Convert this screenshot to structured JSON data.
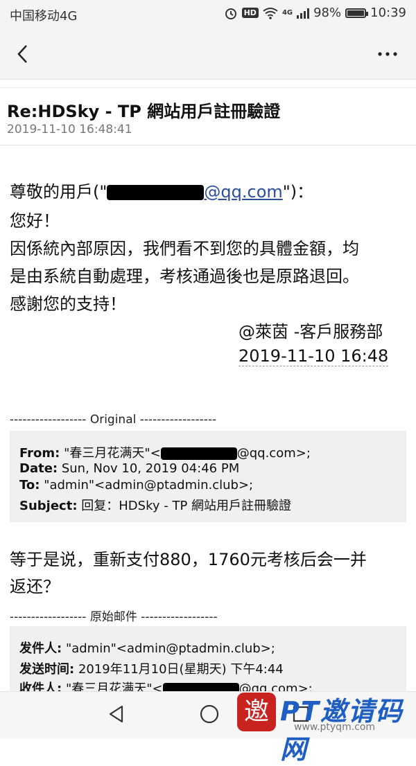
{
  "status_bar": {
    "carrier": "中国移动4G",
    "hd": "HD",
    "network": "4G",
    "battery": "98%",
    "battery_level": 0.98,
    "time": "10:39"
  },
  "header": {
    "subject": "Re:HDSky - TP 網站用戶註冊驗證",
    "date": "2019-11-10 16:48:41"
  },
  "message": {
    "greeting_prefix": "尊敬的用戶(\"",
    "greeting_email_visible": "@qq.com",
    "greeting_suffix": "\")：",
    "hello": "您好！",
    "body_line1": "因係統內部原因，我們看不到您的具體金額，均",
    "body_line2": "是由系統自動處理，考核通過後也是原路退回。",
    "thanks": "感謝您的支持！",
    "signature": "@萊茵 -客戶服務部",
    "signature_date": "2019-11-10 16:48"
  },
  "original1": {
    "divider": "------------------ Original ------------------",
    "from_label": "From:",
    "from_value_prefix": "\"春三月花满天\"<",
    "from_value_suffix": "@qq.com>;",
    "date_label": "Date:",
    "date_value": "Sun, Nov 10, 2019 04:46 PM",
    "to_label": "To:",
    "to_value": "\"admin\"<admin@ptadmin.club>;",
    "subject_label": "Subject:",
    "subject_value": "回复：HDSky - TP 網站用戶註冊驗證"
  },
  "reply": {
    "line1": "等于是说，重新支付880，1760元考核后会一并",
    "line2": "返还？"
  },
  "original2": {
    "divider": "------------------ 原始邮件 ------------------",
    "from_label": "发件人:",
    "from_value": "\"admin\"<admin@ptadmin.club>;",
    "time_label": "发送时间:",
    "time_value": "2019年11月10日(星期天) 下午4:44",
    "to_label": "收件人:",
    "to_value_prefix": "\"春三月花满天\"<",
    "to_value_suffix": "@qq.com>;"
  },
  "watermark": {
    "logo": "邀",
    "title": "PT邀请码网",
    "url": "www.ptyqm.com"
  },
  "icons": [
    "back-arrow-icon",
    "more-icon",
    "alarm-icon",
    "wifi-icon",
    "signal-icon",
    "battery-icon",
    "nav-back-icon",
    "nav-home-icon",
    "nav-recent-icon"
  ]
}
